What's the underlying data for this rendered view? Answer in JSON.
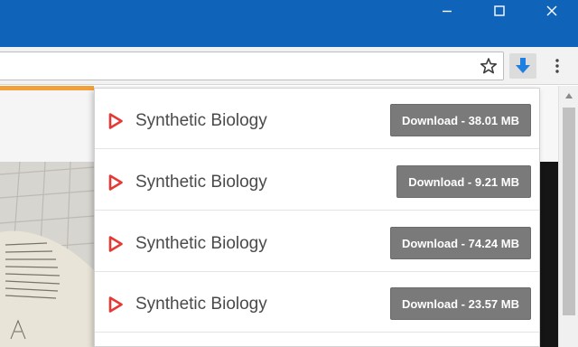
{
  "window": {
    "controls": {
      "minimize": "minimize",
      "maximize": "maximize",
      "close": "close"
    }
  },
  "toolbar": {
    "omnibox_value": "",
    "icons": {
      "bookmark": "star-icon",
      "downloads": "download-arrow-icon",
      "menu": "kebab-menu-icon"
    }
  },
  "downloads_popup": {
    "items": [
      {
        "title": "Synthetic Biology",
        "button_label": "Download - 38.01 MB",
        "icon": "play-triangle-icon"
      },
      {
        "title": "Synthetic Biology",
        "button_label": "Download - 9.21 MB",
        "icon": "play-triangle-icon"
      },
      {
        "title": "Synthetic Biology",
        "button_label": "Download - 74.24 MB",
        "icon": "play-triangle-icon"
      },
      {
        "title": "Synthetic Biology",
        "button_label": "Download - 23.57 MB",
        "icon": "play-triangle-icon"
      }
    ]
  },
  "colors": {
    "titlebar": "#0f64b9",
    "accent_orange": "#f2a03a",
    "play_icon_red": "#e53935",
    "download_button": "#7a7a7a",
    "download_icon_blue": "#1e7fe0"
  }
}
